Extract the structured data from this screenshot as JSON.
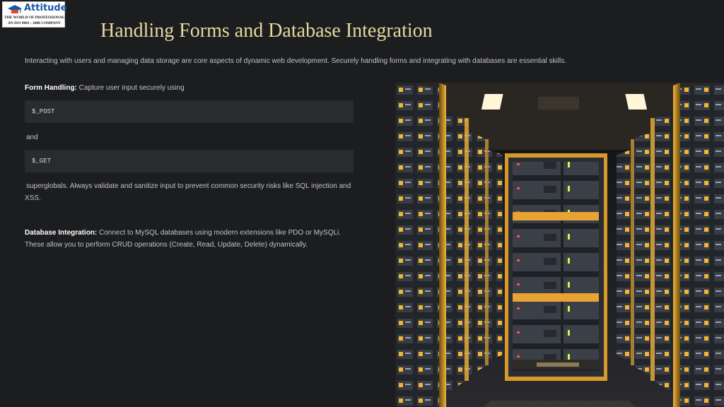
{
  "logo": {
    "name": "Attitude",
    "tagline": "The World Of Professionals",
    "certification": "An ISO 9001 : 2008 Company"
  },
  "slide": {
    "title": "Handling Forms and Database Integration",
    "intro": "Interacting with users and managing data storage are core aspects of dynamic web development. Securely handling forms and integrating with databases are essential skills.",
    "form": {
      "label": "Form Handling:",
      "lead": " Capture user input securely using",
      "code_post": "$_POST",
      "connector": "and",
      "code_get": "$_GET",
      "tail": "superglobals. Always validate and sanitize input to prevent common security risks like SQL injection and XSS."
    },
    "database": {
      "label": "Database Integration:",
      "text": " Connect to MySQL databases using modern extensions like PDO or MySQLi. These allow you to perform CRUD operations (Create, Read, Update, Delete) dynamically."
    }
  },
  "colors": {
    "background": "#1c1d1f",
    "title": "#e8d9a0",
    "code_block": "#2a2b2d",
    "accent_glow": "#f0b43a"
  },
  "image": {
    "icon": "server-room-illustration"
  }
}
